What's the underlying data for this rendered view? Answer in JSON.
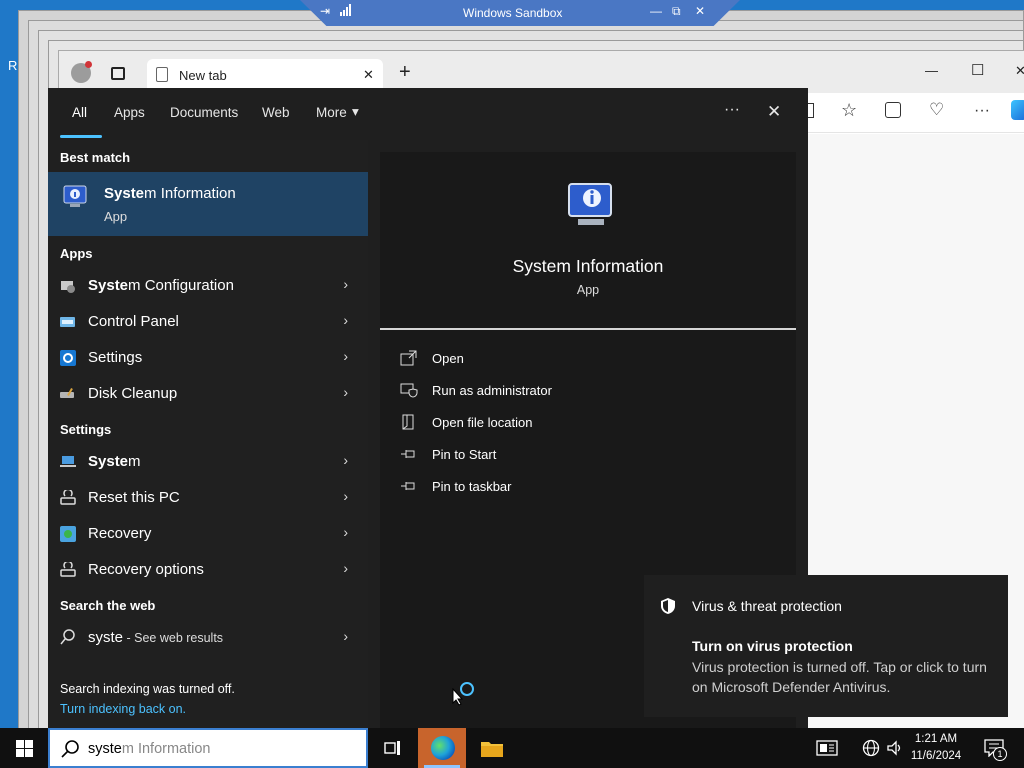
{
  "desktop": {
    "edge_letter": "R"
  },
  "sandbox": {
    "title": "Windows Sandbox"
  },
  "edge": {
    "tab_title": "New tab",
    "new_tab": "+",
    "minimize": "—",
    "maximize": "☐",
    "close": "✕",
    "toolbar_more": "···"
  },
  "search": {
    "tabs": [
      "All",
      "Apps",
      "Documents",
      "Web",
      "More"
    ],
    "more_icon": "▾",
    "options": "···",
    "close": "✕",
    "best_match_heading": "Best match",
    "best_match": {
      "title_bold": "Syste",
      "title_rest": "m Information",
      "subtitle": "App"
    },
    "apps_heading": "Apps",
    "apps": [
      {
        "bold": "Syste",
        "rest": "m Configuration"
      },
      {
        "bold": "",
        "rest": "Control Panel"
      },
      {
        "bold": "",
        "rest": "Settings"
      },
      {
        "bold": "",
        "rest": "Disk Cleanup"
      }
    ],
    "settings_heading": "Settings",
    "settings": [
      {
        "bold": "Syste",
        "rest": "m"
      },
      {
        "bold": "",
        "rest": "Reset this PC"
      },
      {
        "bold": "",
        "rest": "Recovery"
      },
      {
        "bold": "",
        "rest": "Recovery options"
      }
    ],
    "web_heading": "Search the web",
    "web": {
      "query": "syste",
      "suffix": " - See web results"
    },
    "indexing_note": "Search indexing was turned off.",
    "indexing_link": "Turn indexing back on.",
    "chevron": "›"
  },
  "detail": {
    "title": "System Information",
    "subtitle": "App",
    "actions": [
      "Open",
      "Run as administrator",
      "Open file location",
      "Pin to Start",
      "Pin to taskbar"
    ]
  },
  "toast": {
    "header": "Virus & threat protection",
    "title": "Turn on virus protection",
    "body": "Virus protection is turned off. Tap or click to turn on Microsoft Defender Antivirus."
  },
  "taskbar": {
    "search_typed": "syste",
    "search_ghost": "m Information",
    "time": "1:21 AM",
    "date": "11/6/2024",
    "notification_count": "1"
  },
  "colors": {
    "accent": "#4cc2ff",
    "best_match_bg": "#1f4364",
    "panel_bg": "#1f1f1f"
  }
}
